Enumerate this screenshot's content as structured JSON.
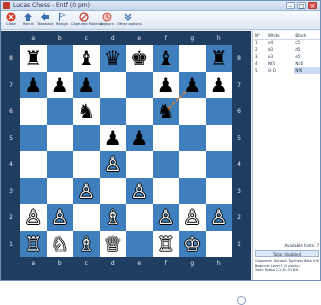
{
  "window": {
    "title": "Lucas Chess - Entf (0 pm)"
  },
  "toolbar": {
    "items": [
      {
        "label": "Close",
        "icon": "close-circle-icon",
        "color": "#d93b2b"
      },
      {
        "label": "Reinit",
        "icon": "reinit-icon",
        "color": "#3a6fb0"
      },
      {
        "label": "Takeback",
        "icon": "takeback-icon",
        "color": "#3a6fb0"
      },
      {
        "label": "Resign",
        "icon": "resign-icon",
        "color": "#3a6fb0"
      },
      {
        "label": "Captured Material",
        "icon": "captured-material-icon",
        "color": "#c0392b"
      },
      {
        "label": "Adjourn",
        "icon": "adjourn-icon",
        "color": "#c0392b"
      },
      {
        "label": "Other options",
        "icon": "other-options-icon",
        "color": "#3a6fb0"
      }
    ]
  },
  "board": {
    "files": [
      "a",
      "b",
      "c",
      "d",
      "e",
      "f",
      "g",
      "h"
    ],
    "ranks": [
      "8",
      "7",
      "6",
      "5",
      "4",
      "3",
      "2",
      "1"
    ],
    "pieces": [
      {
        "square": "a8",
        "glyph": "♜",
        "color": "black",
        "name": "black-rook"
      },
      {
        "square": "c8",
        "glyph": "♝",
        "color": "black",
        "name": "black-bishop"
      },
      {
        "square": "d8",
        "glyph": "♛",
        "color": "black",
        "name": "black-queen"
      },
      {
        "square": "e8",
        "glyph": "♚",
        "color": "black",
        "name": "black-king"
      },
      {
        "square": "f8",
        "glyph": "♝",
        "color": "black",
        "name": "black-bishop"
      },
      {
        "square": "h8",
        "glyph": "♜",
        "color": "black",
        "name": "black-rook"
      },
      {
        "square": "a7",
        "glyph": "♟",
        "color": "black",
        "name": "black-pawn"
      },
      {
        "square": "b7",
        "glyph": "♟",
        "color": "black",
        "name": "black-pawn"
      },
      {
        "square": "c7",
        "glyph": "♟",
        "color": "black",
        "name": "black-pawn"
      },
      {
        "square": "f7",
        "glyph": "♟",
        "color": "black",
        "name": "black-pawn"
      },
      {
        "square": "g7",
        "glyph": "♟",
        "color": "black",
        "name": "black-pawn"
      },
      {
        "square": "h7",
        "glyph": "♟",
        "color": "black",
        "name": "black-pawn"
      },
      {
        "square": "c6",
        "glyph": "♞",
        "color": "black",
        "name": "black-knight"
      },
      {
        "square": "f6",
        "glyph": "♞",
        "color": "black",
        "name": "black-knight"
      },
      {
        "square": "d5",
        "glyph": "♟",
        "color": "black",
        "name": "black-pawn"
      },
      {
        "square": "e5",
        "glyph": "♟",
        "color": "black",
        "name": "black-pawn"
      },
      {
        "square": "d4",
        "glyph": "♙",
        "color": "white",
        "name": "white-pawn"
      },
      {
        "square": "c3",
        "glyph": "♙",
        "color": "white",
        "name": "white-pawn"
      },
      {
        "square": "e3",
        "glyph": "♙",
        "color": "white",
        "name": "white-pawn"
      },
      {
        "square": "a2",
        "glyph": "♙",
        "color": "white",
        "name": "white-pawn"
      },
      {
        "square": "b2",
        "glyph": "♙",
        "color": "white",
        "name": "white-pawn"
      },
      {
        "square": "d2",
        "glyph": "♗",
        "color": "white",
        "name": "white-bishop"
      },
      {
        "square": "f2",
        "glyph": "♙",
        "color": "white",
        "name": "white-pawn"
      },
      {
        "square": "g2",
        "glyph": "♙",
        "color": "white",
        "name": "white-pawn"
      },
      {
        "square": "h2",
        "glyph": "♙",
        "color": "white",
        "name": "white-pawn"
      },
      {
        "square": "a1",
        "glyph": "♖",
        "color": "white",
        "name": "white-rook"
      },
      {
        "square": "b1",
        "glyph": "♘",
        "color": "white",
        "name": "white-knight"
      },
      {
        "square": "c1",
        "glyph": "♗",
        "color": "white",
        "name": "white-bishop"
      },
      {
        "square": "d1",
        "glyph": "♕",
        "color": "white",
        "name": "white-queen"
      },
      {
        "square": "f1",
        "glyph": "♖",
        "color": "white",
        "name": "white-rook"
      },
      {
        "square": "g1",
        "glyph": "♔",
        "color": "white",
        "name": "white-king"
      }
    ],
    "last_move_arrow": {
      "from": "g7",
      "to": "f6",
      "color": "#e67e22"
    }
  },
  "moves": {
    "headers": [
      "N°",
      "White",
      "Black"
    ],
    "rows": [
      {
        "n": "1",
        "white": "e4",
        "black": "c5"
      },
      {
        "n": "2",
        "white": "d3",
        "black": "d5"
      },
      {
        "n": "3",
        "white": "e3",
        "black": "e5"
      },
      {
        "n": "4",
        "white": "Nf3",
        "black": "Nc6"
      },
      {
        "n": "5",
        "white": "O-O",
        "black": "Nf6"
      }
    ]
  },
  "status": {
    "available": "Available hints: 7",
    "tutor": "Tutor disabled",
    "opponent": "Opponent: Tarrasch Toychess Beta 0.905"
  },
  "info": {
    "line1": "Beginner Level 1 (5 points)",
    "line2": "Total: Rybka 2.2.3n-33 64L"
  }
}
